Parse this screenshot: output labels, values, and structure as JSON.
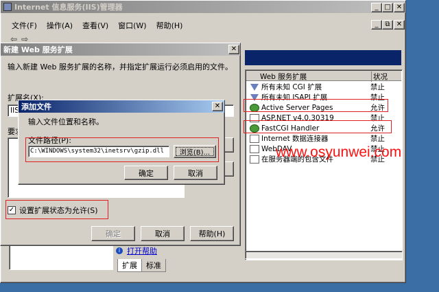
{
  "main_window": {
    "title": "Internet 信息服务(IIS)管理器",
    "menu": [
      "文件(F)",
      "操作(A)",
      "查看(V)",
      "窗口(W)",
      "帮助(H)"
    ]
  },
  "ext_list": {
    "header_name": "Web 服务扩展",
    "header_status": "状况",
    "rows": [
      {
        "name": "所有未知 CGI 扩展",
        "status": "禁止",
        "icon": "funnel-icon"
      },
      {
        "name": "所有未知 ISAPI 扩展",
        "status": "禁止",
        "icon": "funnel-icon"
      },
      {
        "name": "Active Server Pages",
        "status": "允许",
        "icon": "gear-icon"
      },
      {
        "name": "ASP.NET v4.0.30319",
        "status": "禁止",
        "icon": "doc-icon"
      },
      {
        "name": "FastCGI Handler",
        "status": "允许",
        "icon": "gear-icon"
      },
      {
        "name": "Internet 数据连接器",
        "status": "禁止",
        "icon": "doc-icon"
      },
      {
        "name": "WebDAV",
        "status": "禁止",
        "icon": "doc-icon"
      },
      {
        "name": "在服务器端的包含文件",
        "status": "禁止",
        "icon": "doc-icon"
      }
    ],
    "help_link": "打开帮助",
    "tabs": [
      "扩展",
      "标准"
    ]
  },
  "new_ext_dialog": {
    "title": "新建 Web 服务扩展",
    "intro": "输入新建 Web 服务扩展的名称，并指定扩展运行必须启用的文件。",
    "ext_name_label": "扩展名(X):",
    "ext_name_value": "IIS",
    "required_label": "要求",
    "checkbox_label": "设置扩展状态为允许(S)",
    "checkbox_checked": true,
    "ok": "确定",
    "cancel": "取消",
    "help": "帮助(H)"
  },
  "add_file_dialog": {
    "title": "添加文件",
    "instruction": "输入文件位置和名称。",
    "path_label": "文件路径(P):",
    "path_value": "C:\\WINDOWS\\system32\\inetsrv\\gzip.dll",
    "browse": "浏览(B)...",
    "ok": "确定",
    "cancel": "取消"
  },
  "watermark": "www.osyunwei.com"
}
